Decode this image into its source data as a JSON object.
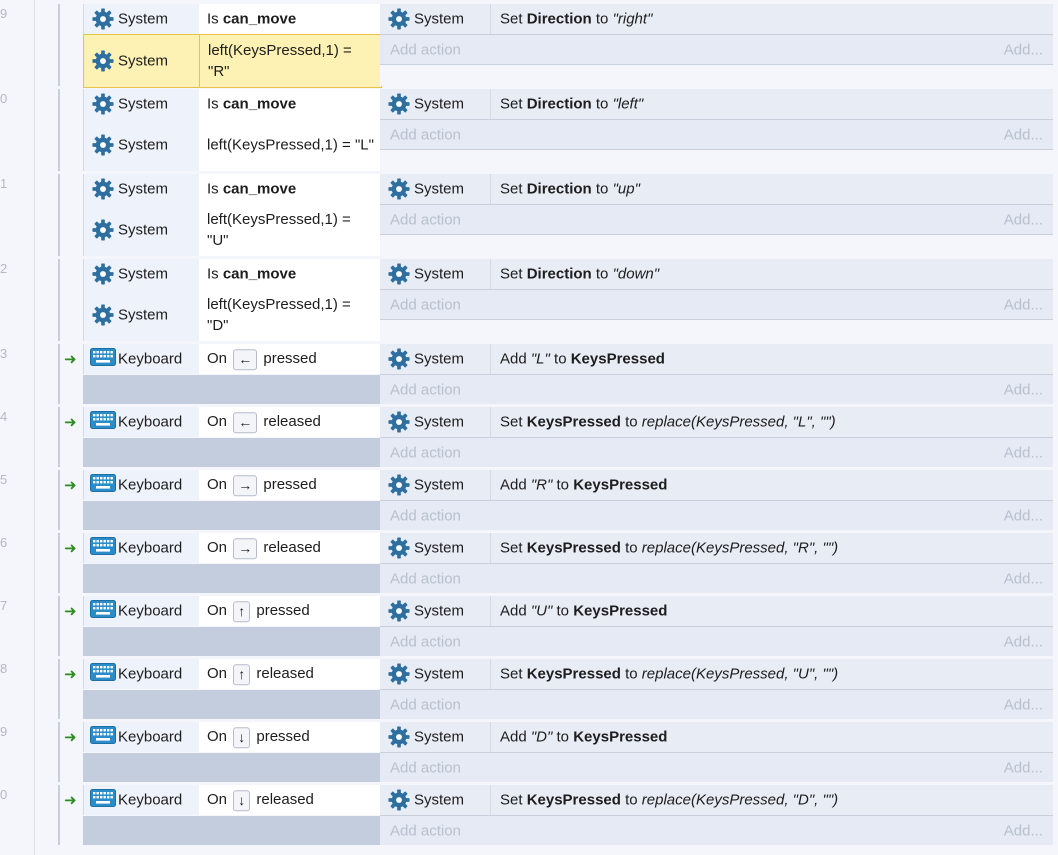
{
  "colors": {
    "accent": "#2f6fa0",
    "trigger": "#2e8b22",
    "selection": "#fdf1b3"
  },
  "icons": {
    "system": "gear-icon",
    "keyboard": "keyboard-icon",
    "trigger": "green-arrow-icon"
  },
  "add_action_label": "Add action",
  "add_label": "Add...",
  "events": [
    {
      "num": "9",
      "conditions": [
        {
          "object": "System",
          "parts": [
            {
              "t": "Is "
            },
            {
              "b": "can_move"
            }
          ]
        },
        {
          "object": "System",
          "parts": [
            {
              "t": "left(KeysPressed,1) = \"R\""
            }
          ],
          "selected": true
        }
      ],
      "actions": [
        {
          "object": "System",
          "parts": [
            {
              "t": "Set "
            },
            {
              "b": "Direction"
            },
            {
              "t": " to "
            },
            {
              "i": "\"right\""
            }
          ]
        }
      ]
    },
    {
      "num": "0",
      "conditions": [
        {
          "object": "System",
          "parts": [
            {
              "t": "Is "
            },
            {
              "b": "can_move"
            }
          ]
        },
        {
          "object": "System",
          "parts": [
            {
              "t": "left(KeysPressed,1) = \"L\""
            }
          ]
        }
      ],
      "actions": [
        {
          "object": "System",
          "parts": [
            {
              "t": "Set "
            },
            {
              "b": "Direction"
            },
            {
              "t": " to "
            },
            {
              "i": "\"left\""
            }
          ]
        }
      ]
    },
    {
      "num": "1",
      "conditions": [
        {
          "object": "System",
          "parts": [
            {
              "t": "Is "
            },
            {
              "b": "can_move"
            }
          ]
        },
        {
          "object": "System",
          "parts": [
            {
              "t": "left(KeysPressed,1) = \"U\""
            }
          ]
        }
      ],
      "actions": [
        {
          "object": "System",
          "parts": [
            {
              "t": "Set "
            },
            {
              "b": "Direction"
            },
            {
              "t": " to "
            },
            {
              "i": "\"up\""
            }
          ]
        }
      ]
    },
    {
      "num": "2",
      "conditions": [
        {
          "object": "System",
          "parts": [
            {
              "t": "Is "
            },
            {
              "b": "can_move"
            }
          ]
        },
        {
          "object": "System",
          "parts": [
            {
              "t": "left(KeysPressed,1) = \"D\""
            }
          ]
        }
      ],
      "actions": [
        {
          "object": "System",
          "parts": [
            {
              "t": "Set "
            },
            {
              "b": "Direction"
            },
            {
              "t": " to "
            },
            {
              "i": "\"down\""
            }
          ]
        }
      ]
    },
    {
      "num": "3",
      "trigger": true,
      "conditions": [
        {
          "object": "Keyboard",
          "parts": [
            {
              "t": "On "
            },
            {
              "k": "←"
            },
            {
              "t": " pressed"
            }
          ]
        }
      ],
      "actions": [
        {
          "object": "System",
          "parts": [
            {
              "t": "Add "
            },
            {
              "i": "\"L\""
            },
            {
              "t": " to "
            },
            {
              "b": "KeysPressed"
            }
          ]
        }
      ]
    },
    {
      "num": "4",
      "trigger": true,
      "conditions": [
        {
          "object": "Keyboard",
          "parts": [
            {
              "t": "On "
            },
            {
              "k": "←"
            },
            {
              "t": " released"
            }
          ]
        }
      ],
      "actions": [
        {
          "object": "System",
          "parts": [
            {
              "t": "Set "
            },
            {
              "b": "KeysPressed"
            },
            {
              "t": " to "
            },
            {
              "i": "replace(KeysPressed, \"L\", \"\")"
            }
          ]
        }
      ]
    },
    {
      "num": "5",
      "trigger": true,
      "conditions": [
        {
          "object": "Keyboard",
          "parts": [
            {
              "t": "On "
            },
            {
              "k": "→"
            },
            {
              "t": " pressed"
            }
          ]
        }
      ],
      "actions": [
        {
          "object": "System",
          "parts": [
            {
              "t": "Add "
            },
            {
              "i": "\"R\""
            },
            {
              "t": " to "
            },
            {
              "b": "KeysPressed"
            }
          ]
        }
      ]
    },
    {
      "num": "6",
      "trigger": true,
      "conditions": [
        {
          "object": "Keyboard",
          "parts": [
            {
              "t": "On "
            },
            {
              "k": "→"
            },
            {
              "t": " released"
            }
          ]
        }
      ],
      "actions": [
        {
          "object": "System",
          "parts": [
            {
              "t": "Set "
            },
            {
              "b": "KeysPressed"
            },
            {
              "t": " to "
            },
            {
              "i": "replace(KeysPressed, \"R\", \"\")"
            }
          ]
        }
      ]
    },
    {
      "num": "7",
      "trigger": true,
      "conditions": [
        {
          "object": "Keyboard",
          "parts": [
            {
              "t": "On "
            },
            {
              "k": "↑"
            },
            {
              "t": " pressed"
            }
          ]
        }
      ],
      "actions": [
        {
          "object": "System",
          "parts": [
            {
              "t": "Add "
            },
            {
              "i": "\"U\""
            },
            {
              "t": " to "
            },
            {
              "b": "KeysPressed"
            }
          ]
        }
      ]
    },
    {
      "num": "8",
      "trigger": true,
      "conditions": [
        {
          "object": "Keyboard",
          "parts": [
            {
              "t": "On "
            },
            {
              "k": "↑"
            },
            {
              "t": " released"
            }
          ]
        }
      ],
      "actions": [
        {
          "object": "System",
          "parts": [
            {
              "t": "Set "
            },
            {
              "b": "KeysPressed"
            },
            {
              "t": " to "
            },
            {
              "i": "replace(KeysPressed, \"U\", \"\")"
            }
          ]
        }
      ]
    },
    {
      "num": "9",
      "trigger": true,
      "conditions": [
        {
          "object": "Keyboard",
          "parts": [
            {
              "t": "On "
            },
            {
              "k": "↓"
            },
            {
              "t": " pressed"
            }
          ]
        }
      ],
      "actions": [
        {
          "object": "System",
          "parts": [
            {
              "t": "Add "
            },
            {
              "i": "\"D\""
            },
            {
              "t": " to "
            },
            {
              "b": "KeysPressed"
            }
          ]
        }
      ]
    },
    {
      "num": "0",
      "trigger": true,
      "conditions": [
        {
          "object": "Keyboard",
          "parts": [
            {
              "t": "On "
            },
            {
              "k": "↓"
            },
            {
              "t": " released"
            }
          ]
        }
      ],
      "actions": [
        {
          "object": "System",
          "parts": [
            {
              "t": "Set "
            },
            {
              "b": "KeysPressed"
            },
            {
              "t": " to "
            },
            {
              "i": "replace(KeysPressed, \"D\", \"\")"
            }
          ]
        }
      ]
    }
  ]
}
